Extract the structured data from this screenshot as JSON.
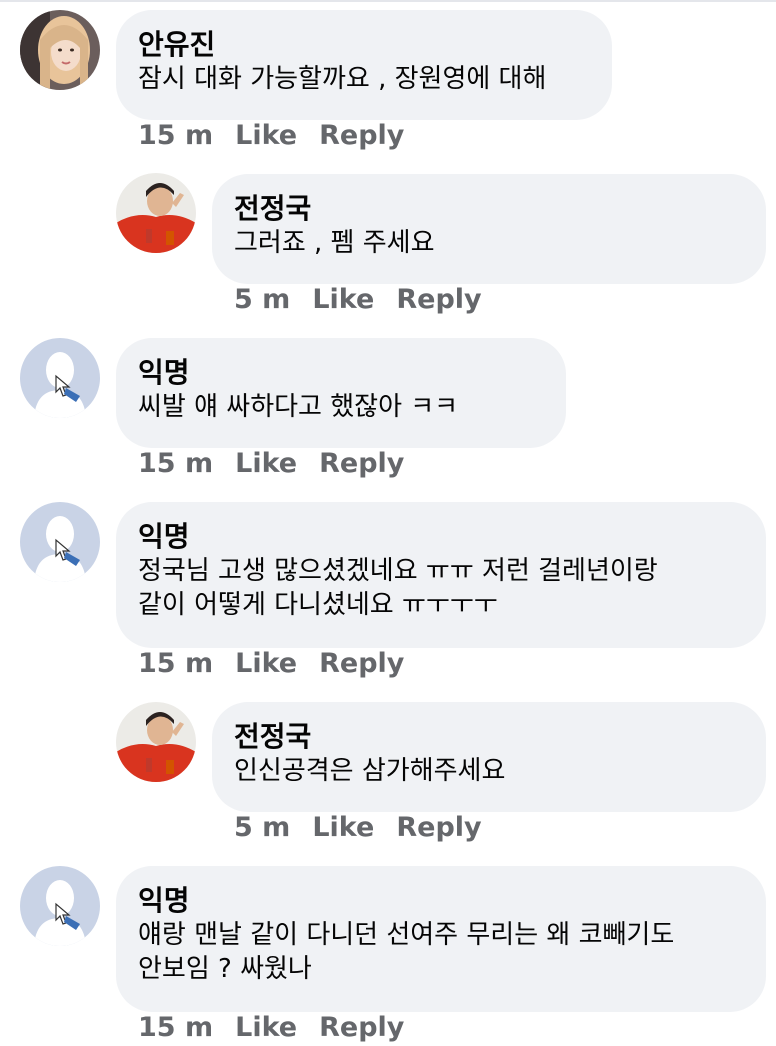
{
  "comments": [
    {
      "author": "안유진",
      "text": "잠시 대화 가능할까요 , 장원영에 대해",
      "time": "15 m",
      "like": "Like",
      "reply": "Reply",
      "avatar": "woman-photo"
    },
    {
      "author": "전정국",
      "text": "그러죠 , 펨 주세요",
      "time": "5 m",
      "like": "Like",
      "reply": "Reply",
      "avatar": "man-photo"
    },
    {
      "author": "익명",
      "text": "씨발 얘 싸하다고 했잖아 ㅋㅋ",
      "time": "15 m",
      "like": "Like",
      "reply": "Reply",
      "avatar": "anonymous-silhouette"
    },
    {
      "author": "익명",
      "text": "정국님 고생 많으셨겠네요 ㅠㅠ 저런 걸레년이랑\n같이 어떻게 다니셨네요 ㅠㅜㅜㅜ",
      "time": "15 m",
      "like": "Like",
      "reply": "Reply",
      "avatar": "anonymous-silhouette"
    },
    {
      "author": "전정국",
      "text": "인신공격은 삼가해주세요",
      "time": "5 m",
      "like": "Like",
      "reply": "Reply",
      "avatar": "man-photo"
    },
    {
      "author": "익명",
      "text": "얘랑 맨날 같이 다니던 선여주 무리는 왜 코빼기도\n안보임 ? 싸웠나",
      "time": "15 m",
      "like": "Like",
      "reply": "Reply",
      "avatar": "anonymous-silhouette"
    }
  ]
}
